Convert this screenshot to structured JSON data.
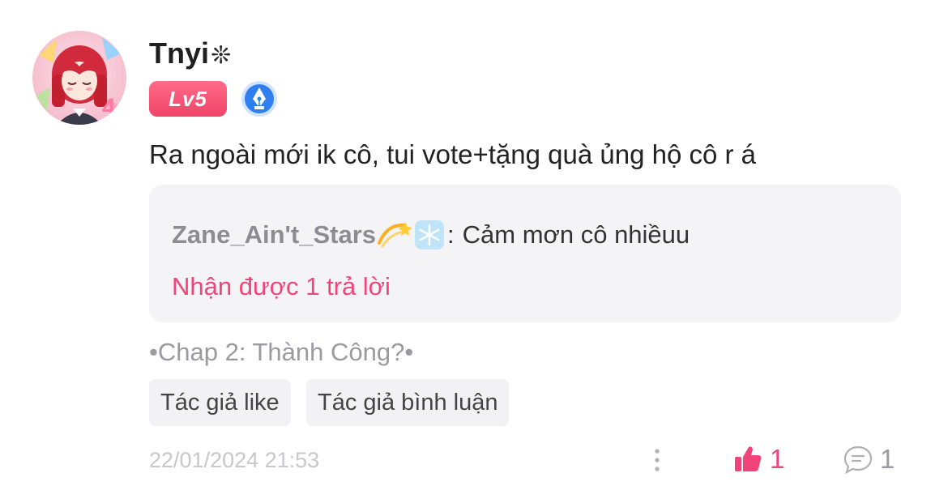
{
  "comment": {
    "username": "Tnyi",
    "username_decoration": "❊",
    "level": "Lv5",
    "badge_icon": "pen-nib-icon",
    "avatar_icon": "anime-avatar",
    "text": "Ra ngoài mới ik cô, tui vote+tặng quà ủng hộ cô r á",
    "reply": {
      "author": "Zane_Ain't_Stars",
      "emojis": [
        "dizzy-icon",
        "snowflake-icon"
      ],
      "separator": ":",
      "text": "Cảm mơn cô nhiềuu",
      "count_label": "Nhận được 1 trả lời"
    },
    "chapter": "•Chap 2: Thành Công?•",
    "tags": [
      "Tác giả like",
      "Tác giả bình luận"
    ],
    "timestamp": "22/01/2024 21:53",
    "likes": "1",
    "replies": "1"
  },
  "colors": {
    "accent_pink": "#f0457a",
    "level_badge": "#f04468",
    "badge_blue": "#2f7ff0",
    "muted_text": "#9a9aa0",
    "reply_bg": "#f4f4f6"
  }
}
